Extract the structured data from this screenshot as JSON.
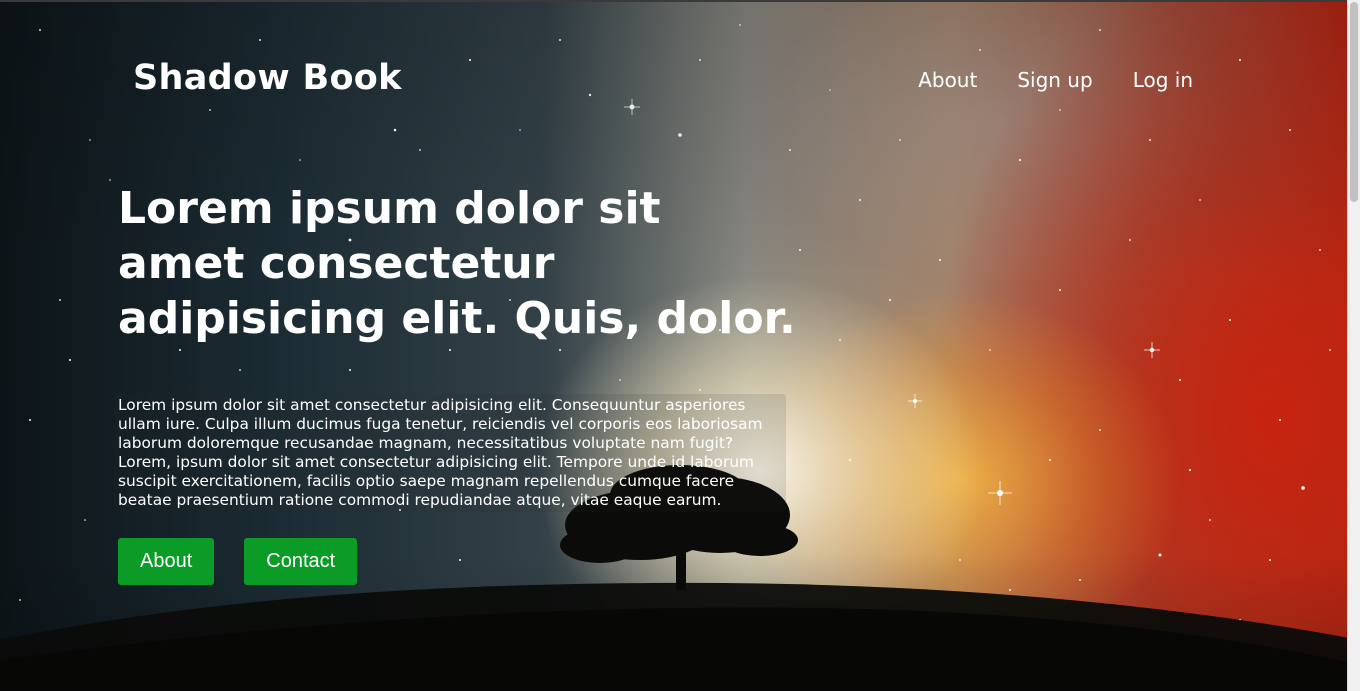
{
  "brand": "Shadow Book",
  "nav": {
    "links": [
      "About",
      "Sign up",
      "Log in"
    ]
  },
  "hero": {
    "title": "Lorem ipsum dolor sit amet consectetur adipisicing elit. Quis, dolor.",
    "paragraph": "Lorem ipsum dolor sit amet consectetur adipisicing elit. Consequuntur asperiores ullam iure. Culpa illum ducimus fuga tenetur, reiciendis vel corporis eos laboriosam laborum doloremque recusandae magnam, necessitatibus voluptate nam fugit? Lorem, ipsum dolor sit amet consectetur adipisicing elit. Tempore unde id laborum suscipit exercitationem, facilis optio saepe magnam repellendus cumque facere beatae praesentium ratione commodi repudiandae atque, vitae eaque earum.",
    "buttons": [
      "About",
      "Contact"
    ]
  },
  "colors": {
    "button_bg": "#0a9c27",
    "text": "#ffffff"
  }
}
